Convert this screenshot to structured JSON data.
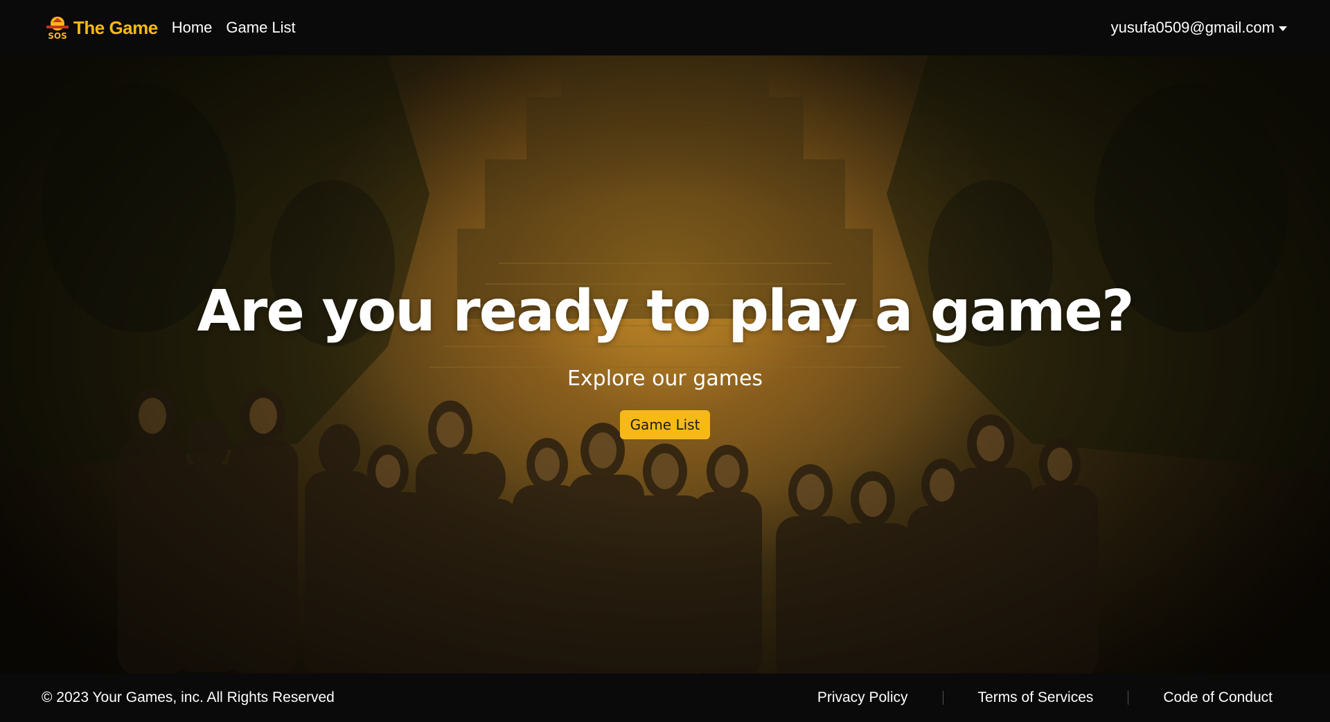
{
  "navbar": {
    "brand_name": "The Game",
    "logo_text": "SOS",
    "links": [
      "Home",
      "Game List"
    ],
    "user_email": "yusufa0509@gmail.com"
  },
  "hero": {
    "title": "Are you ready to play a game?",
    "subtitle": "Explore our games",
    "button_label": "Game List"
  },
  "footer": {
    "copyright": "© 2023 Your Games, inc. All Rights Reserved",
    "links": [
      "Privacy Policy",
      "Terms of Services",
      "Code of Conduct"
    ]
  },
  "colors": {
    "accent": "#f6b917",
    "navbar_bg": "#0a0a0b",
    "text": "#ffffff"
  }
}
